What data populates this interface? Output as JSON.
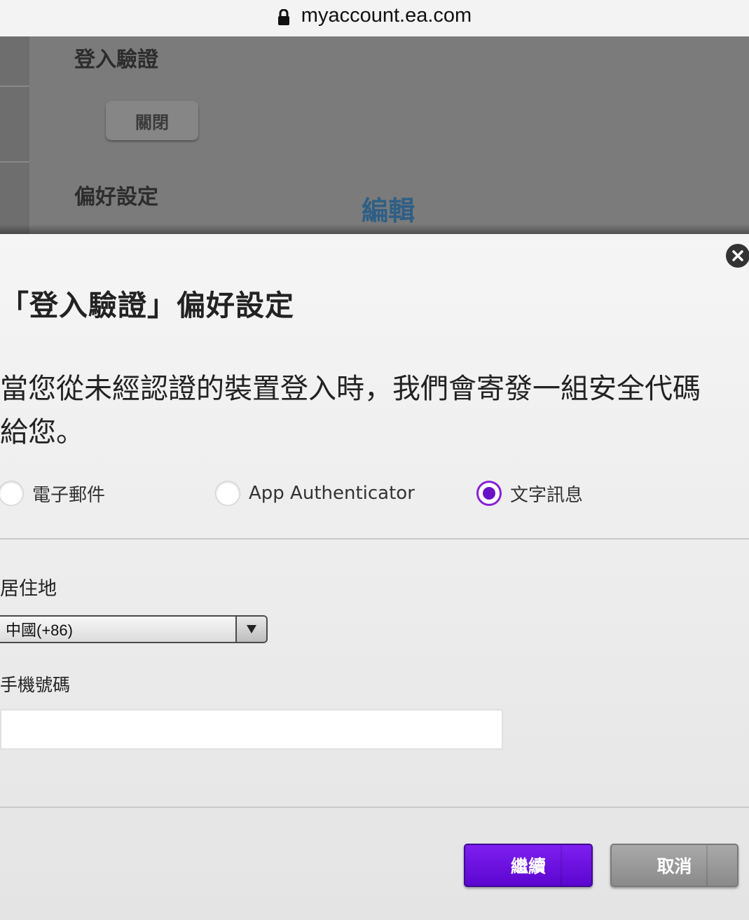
{
  "browser": {
    "url": "myaccount.ea.com",
    "lock_icon": "lock-icon"
  },
  "background_page": {
    "section1_title": "登入驗證",
    "section1_button": "關閉",
    "section2_title": "偏好設定",
    "section2_link": "編輯"
  },
  "modal": {
    "close_icon": "close-icon",
    "title": "「登入驗證」偏好設定",
    "description": "當您從未經認證的裝置登入時，我們會寄發一組安全代碼給您。",
    "options": [
      {
        "label": "電子郵件",
        "selected": false
      },
      {
        "label": "App Authenticator",
        "selected": false
      },
      {
        "label": "文字訊息",
        "selected": true
      }
    ],
    "residence_label": "居住地",
    "residence_value": "中國(+86)",
    "phone_label": "手機號碼",
    "phone_value": "",
    "continue_label": "繼續",
    "cancel_label": "取消",
    "colors": {
      "accent": "#6a12c8",
      "continue_bg": "#6b10e0",
      "cancel_bg": "#9a9a9a"
    }
  }
}
